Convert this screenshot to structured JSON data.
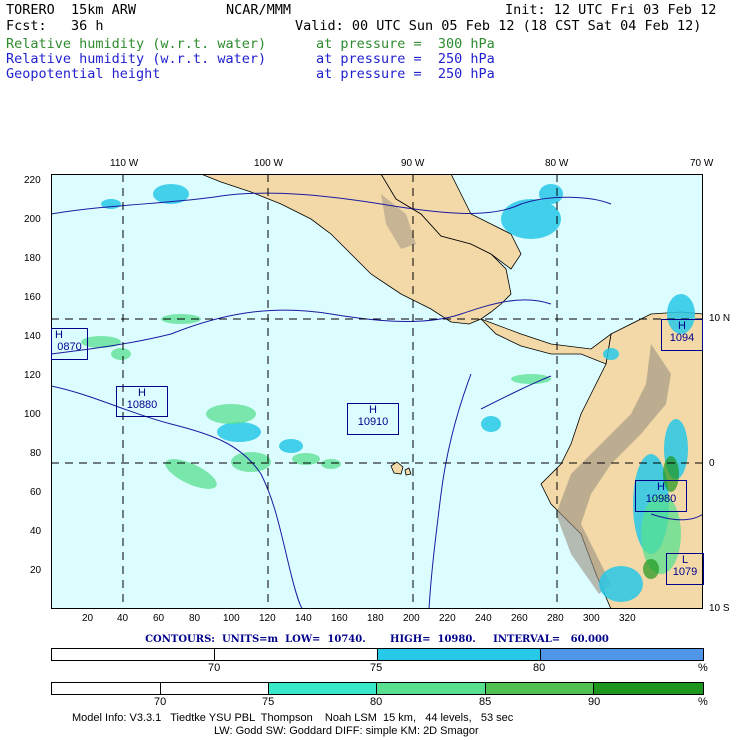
{
  "header": {
    "line1_left": "TORERO  15km ARW",
    "line1_center": "NCAR/MMM",
    "line1_right": "Init: 12 UTC Fri 03 Feb 12",
    "line2_left": "Fcst:   36 h",
    "line2_right": "Valid: 00 UTC Sun 05 Feb 12 (18 CST Sat 04 Feb 12)",
    "fields": [
      {
        "name": "Relative humidity (w.r.t. water)",
        "level": "at pressure =  300 hPa",
        "color": "#2e8b2e"
      },
      {
        "name": "Relative humidity (w.r.t. water)",
        "level": "at pressure =  250 hPa",
        "color": "#1f1fd0"
      },
      {
        "name": "Geopotential height",
        "level": "at pressure =  250 hPa",
        "color": "#1f1fd0"
      }
    ]
  },
  "map": {
    "top_lon_labels": [
      "110 W",
      "100 W",
      "90 W",
      "80 W",
      "70 W"
    ],
    "right_lat_labels": [
      "10 N",
      "0",
      "10 S"
    ],
    "left_ticks": [
      "220",
      "200",
      "180",
      "160",
      "140",
      "120",
      "100",
      "80",
      "60",
      "40",
      "20"
    ],
    "bottom_ticks": [
      "20",
      "40",
      "60",
      "80",
      "100",
      "120",
      "140",
      "160",
      "180",
      "200",
      "220",
      "240",
      "260",
      "280",
      "300",
      "320"
    ],
    "ocean_color": "#dcfdff",
    "land_color": "#f3d9a8",
    "highs_lows": [
      {
        "type": "H",
        "value": "0870"
      },
      {
        "type": "H",
        "value": "10880"
      },
      {
        "type": "H",
        "value": "10910"
      },
      {
        "type": "H",
        "value": "1094"
      },
      {
        "type": "H",
        "value": "10980"
      },
      {
        "type": "L",
        "value": "1079"
      }
    ]
  },
  "contours_text": "CONTOURS:  UNITS=m  LOW=  10740.       HIGH=  10980.     INTERVAL=   60.000",
  "legend_blue": {
    "labels": [
      "70",
      "75",
      "80"
    ],
    "unit": "%",
    "colors": [
      "#ffffff",
      "#ffffff",
      "#28c8e8",
      "#5096e8"
    ]
  },
  "legend_green": {
    "labels": [
      "70",
      "75",
      "80",
      "85",
      "90"
    ],
    "unit": "%",
    "colors": [
      "#ffffff",
      "#ffffff",
      "#38e8c8",
      "#58e090",
      "#50c050",
      "#1e961e"
    ]
  },
  "footer": {
    "line1": "Model Info: V3.3.1   Tiedtke YSU PBL  Thompson    Noah LSM  15 km,   44 levels,   53 sec",
    "line2": "LW: Godd SW: Goddard DIFF: simple KM: 2D Smagor"
  }
}
